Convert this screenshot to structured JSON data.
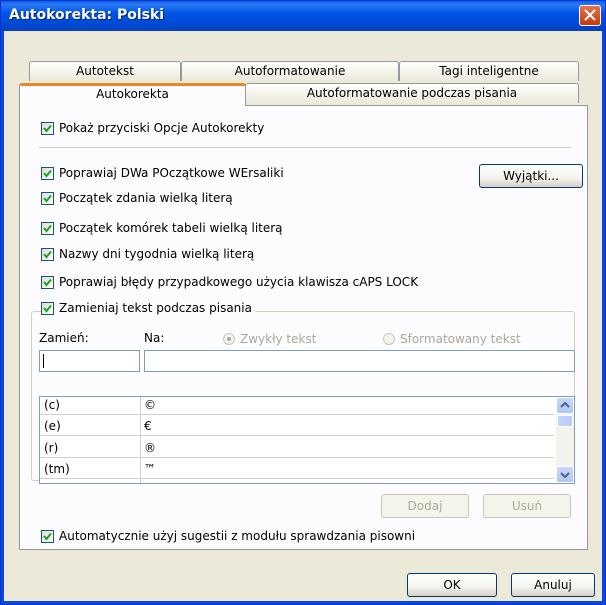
{
  "window": {
    "title": "Autokorekta: Polski"
  },
  "tabs": {
    "row1": [
      {
        "label": "Autotekst"
      },
      {
        "label": "Autoformatowanie"
      },
      {
        "label": "Tagi inteligentne"
      }
    ],
    "row2": [
      {
        "label": "Autokorekta",
        "active": true
      },
      {
        "label": "Autoformatowanie podczas pisania"
      }
    ]
  },
  "options": {
    "show_buttons": {
      "label": "Pokaż przyciski Opcje Autokorekty",
      "checked": true
    },
    "two_initials": {
      "label": "Poprawiaj DWa POczątkowe WErsaliki",
      "checked": true
    },
    "sentence_caps": {
      "label": "Początek zdania wielką literą",
      "checked": true
    },
    "table_cells": {
      "label": "Początek komórek tabeli wielką literą",
      "checked": true
    },
    "day_names": {
      "label": "Nazwy dni tygodnia wielką literą",
      "checked": true
    },
    "caps_lock": {
      "label": "Poprawiaj błędy przypadkowego użycia klawisza cAPS LOCK",
      "checked": true
    },
    "replace_text": {
      "label": "Zamieniaj tekst podczas pisania",
      "checked": true
    },
    "auto_suggest": {
      "label": "Automatycznie użyj sugestii z modułu sprawdzania pisowni",
      "checked": true
    }
  },
  "buttons": {
    "exceptions": "Wyjątki...",
    "add": "Dodaj",
    "delete": "Usuń",
    "ok": "OK",
    "cancel": "Anuluj"
  },
  "replace": {
    "replace_label": "Zamień:",
    "with_label": "Na:",
    "plain_text": "Zwykły tekst",
    "formatted_text": "Sformatowany tekst",
    "replace_value": "",
    "with_value": ""
  },
  "entries": [
    {
      "from": "(c)",
      "to": "©"
    },
    {
      "from": "(e)",
      "to": "€"
    },
    {
      "from": "(r)",
      "to": "®"
    },
    {
      "from": "(tm)",
      "to": "™"
    }
  ]
}
